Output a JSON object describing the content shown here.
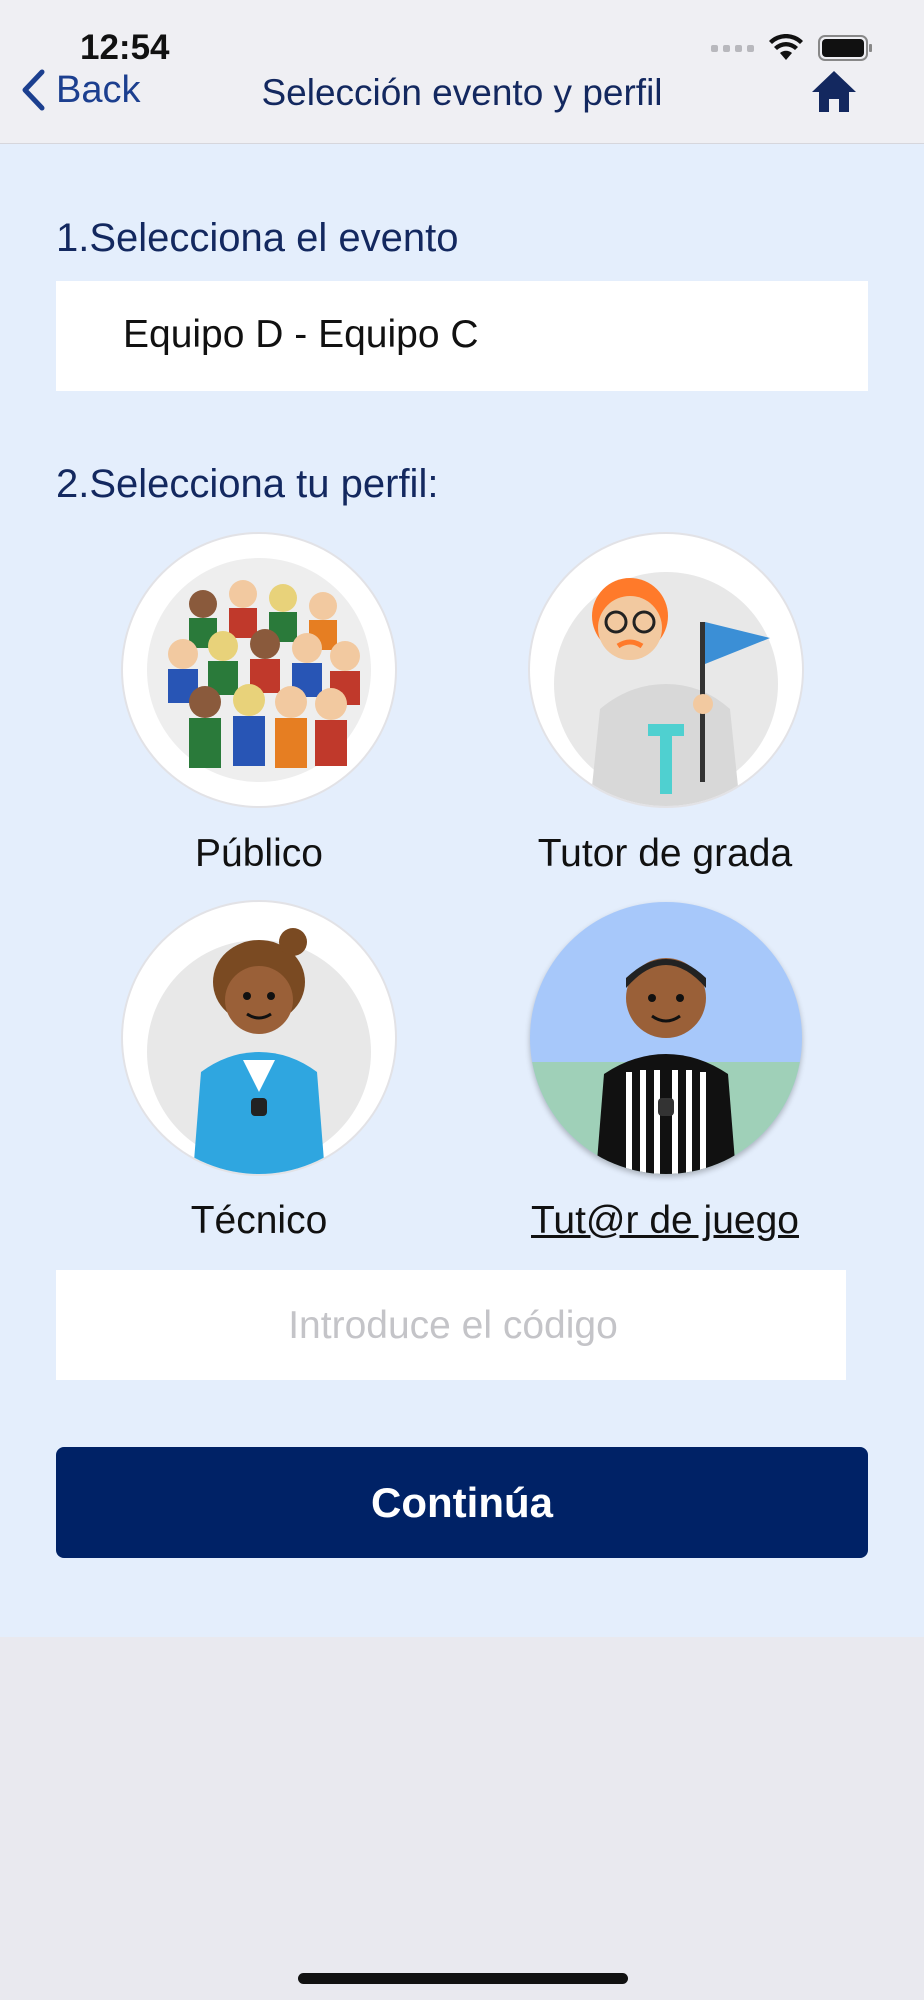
{
  "status_bar": {
    "time": "12:54",
    "wifi_icon": "wifi-icon",
    "battery_icon": "battery-icon"
  },
  "nav": {
    "back_label": "Back",
    "title": "Selección evento y perfil",
    "home_icon": "home-icon"
  },
  "event_section": {
    "label": "1.Selecciona el evento",
    "selected_event": "Equipo D - Equipo C"
  },
  "profile_section": {
    "label": "2.Selecciona tu perfil:",
    "profiles": [
      {
        "label": "Público",
        "selected": false
      },
      {
        "label": "Tutor de grada",
        "selected": false
      },
      {
        "label": "Técnico",
        "selected": false
      },
      {
        "label": "Tut@r de juego",
        "selected": true
      }
    ]
  },
  "code_input": {
    "placeholder": "Introduce el código",
    "value": ""
  },
  "continue_label": "Continúa",
  "colors": {
    "accent": "#002266",
    "nav_text": "#13285f",
    "content_bg": "#e4eefc",
    "selected_avatar_bg": "#a7c8fa"
  }
}
